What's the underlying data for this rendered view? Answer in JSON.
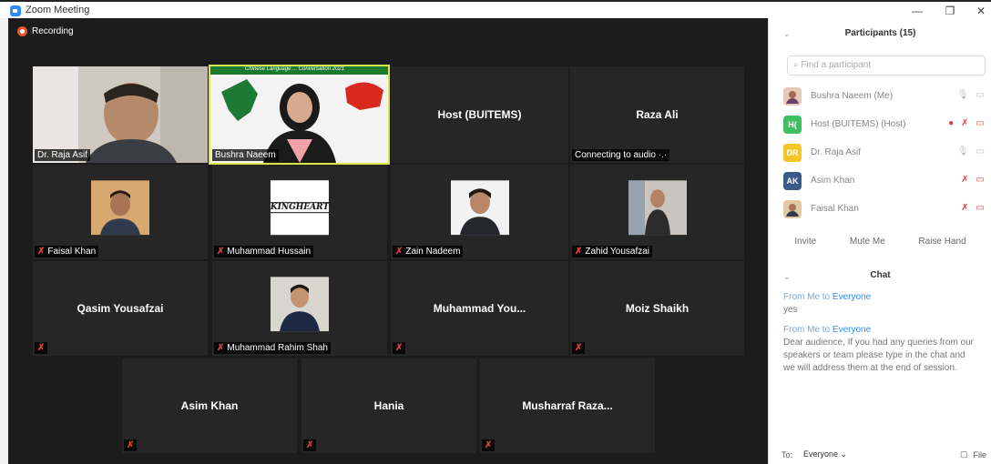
{
  "window": {
    "title": "Zoom Meeting",
    "minimize": "—",
    "restore": "❐",
    "close": "✕"
  },
  "recording_label": "Recording",
  "tiles": {
    "raja": "Dr. Raja Asif",
    "bushra": "Bushra Naeem",
    "host": "Host (BUITEMS)",
    "raza_center": "Raza Ali",
    "raza_label": "Connecting to audio ·.·",
    "faisal": "Faisal Khan",
    "hussain": "Muhammad Hussain",
    "zain": "Zain Nadeem",
    "zahid": "Zahid Yousafzai",
    "qasim": "Qasim Yousafzai",
    "rahim": "Muhammad Rahim Shah",
    "muhammad_you": "Muhammad  You...",
    "moiz": "Moiz Shaikh",
    "asim": "Asim Khan",
    "hania": "Hania",
    "musharraf": "Musharraf  Raza..."
  },
  "banner_text": "Chinese Language ... Conversation 2021",
  "kingheart": "KINGHEART",
  "panel": {
    "participants_title": "Participants (15)",
    "search_placeholder": "Find a participant",
    "participants": [
      {
        "initials": "",
        "name": "Bushra Naeem (Me)",
        "color": "#b88a7a"
      },
      {
        "initials": "H(",
        "name": "Host (BUITEMS) (Host)",
        "color": "#3fbf62"
      },
      {
        "initials": "DR",
        "name": "Dr. Raja Asif",
        "color": "#f3c624"
      },
      {
        "initials": "AK",
        "name": "Asim Khan",
        "color": "#3a5b8a"
      },
      {
        "initials": "",
        "name": "Faisal Khan",
        "color": "#c9a37a"
      }
    ],
    "invite": "Invite",
    "mute_me": "Mute Me",
    "raise_hand": "Raise Hand",
    "chat_title": "Chat",
    "chat": [
      {
        "from": "From Me to",
        "to": "Everyone",
        "text": "yes"
      },
      {
        "from": "From Me to",
        "to": "Everyone",
        "text": "Dear audience, If you had any queries from our speakers or team please type in the chat and we will address them at the end of session."
      }
    ],
    "to_label": "To:",
    "to_value": "Everyone ⌄",
    "file_label": "File"
  }
}
